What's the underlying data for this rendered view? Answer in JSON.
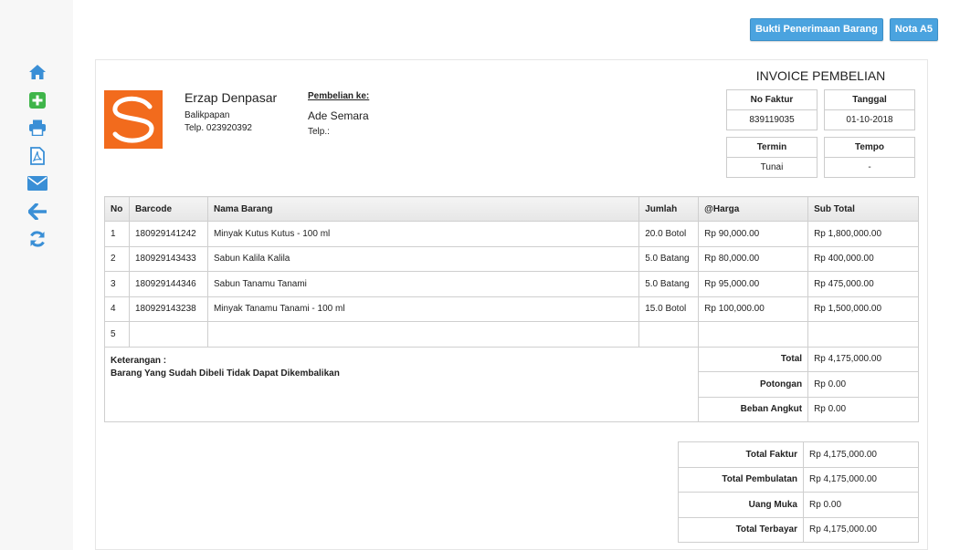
{
  "buttons": {
    "bukti": "Bukti Penerimaan Barang",
    "nota": "Nota A5"
  },
  "sidebar": {
    "items": [
      {
        "icon": "home-icon",
        "color": "#3a8fd6"
      },
      {
        "icon": "add-icon",
        "color": "#3fb54a"
      },
      {
        "icon": "print-icon",
        "color": "#3a8fd6"
      },
      {
        "icon": "pdf-icon",
        "color": "#3a8fd6"
      },
      {
        "icon": "email-icon",
        "color": "#3a8fd6"
      },
      {
        "icon": "back-arrow-icon",
        "color": "#3a8fd6"
      },
      {
        "icon": "refresh-icon",
        "color": "#3a8fd6"
      }
    ]
  },
  "company": {
    "name": "Erzap Denpasar",
    "city": "Balikpapan",
    "phone": "Telp. 023920392",
    "logo_color": "#f26b1d"
  },
  "buyer": {
    "label": "Pembelian ke:",
    "name": "Ade Semara",
    "phone": "Telp.:"
  },
  "invoice": {
    "title": "INVOICE PEMBELIAN",
    "no_faktur_label": "No Faktur",
    "no_faktur": "839119035",
    "tanggal_label": "Tanggal",
    "tanggal": "01-10-2018",
    "termin_label": "Termin",
    "termin": "Tunai",
    "tempo_label": "Tempo",
    "tempo": "-"
  },
  "table": {
    "headers": [
      "No",
      "Barcode",
      "Nama Barang",
      "Jumlah",
      "@Harga",
      "Sub Total"
    ],
    "rows": [
      {
        "no": "1",
        "barcode": "180929141242",
        "nama": "Minyak Kutus Kutus - 100 ml",
        "jumlah": "20.0 Botol",
        "harga": "Rp 90,000.00",
        "subtotal": "Rp 1,800,000.00"
      },
      {
        "no": "2",
        "barcode": "180929143433",
        "nama": "Sabun Kalila Kalila",
        "jumlah": "5.0 Batang",
        "harga": "Rp 80,000.00",
        "subtotal": "Rp 400,000.00"
      },
      {
        "no": "3",
        "barcode": "180929144346",
        "nama": "Sabun Tanamu Tanami",
        "jumlah": "5.0 Batang",
        "harga": "Rp 95,000.00",
        "subtotal": "Rp 475,000.00"
      },
      {
        "no": "4",
        "barcode": "180929143238",
        "nama": "Minyak Tanamu Tanami - 100 ml",
        "jumlah": "15.0 Botol",
        "harga": "Rp 100,000.00",
        "subtotal": "Rp 1,500,000.00"
      },
      {
        "no": "5",
        "barcode": "",
        "nama": "",
        "jumlah": "",
        "harga": "",
        "subtotal": ""
      }
    ]
  },
  "notes": {
    "label": "Keterangan :",
    "text": "Barang Yang Sudah Dibeli Tidak Dapat Dikembalikan"
  },
  "summary": {
    "total_label": "Total",
    "total": "Rp 4,175,000.00",
    "potongan_label": "Potongan",
    "potongan": "Rp 0.00",
    "beban_label": "Beban Angkut",
    "beban": "Rp 0.00"
  },
  "totals": {
    "total_faktur_label": "Total Faktur",
    "total_faktur": "Rp 4,175,000.00",
    "total_pembulatan_label": "Total Pembulatan",
    "total_pembulatan": "Rp 4,175,000.00",
    "uang_muka_label": "Uang Muka",
    "uang_muka": "Rp 0.00",
    "total_terbayar_label": "Total Terbayar",
    "total_terbayar": "Rp 4,175,000.00"
  }
}
